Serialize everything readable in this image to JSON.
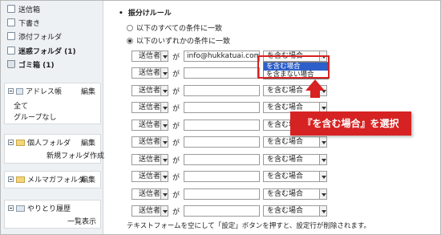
{
  "sidebar": {
    "folders": [
      {
        "label": "送信箱",
        "bold": false,
        "icon": "outbox-icon"
      },
      {
        "label": "下書き",
        "bold": false,
        "icon": "draft-icon"
      },
      {
        "label": "添付フォルダ",
        "bold": false,
        "icon": "attachment-folder-icon"
      },
      {
        "label": "迷惑フォルダ (1)",
        "bold": true,
        "icon": "spam-folder-icon"
      },
      {
        "label": "ゴミ箱 (1)",
        "bold": true,
        "icon": "trash-icon"
      }
    ],
    "address_book": {
      "title": "アドレス帳",
      "edit": "編集",
      "items": [
        "全て",
        "グループなし"
      ]
    },
    "personal": {
      "title": "個人フォルダ",
      "edit": "編集",
      "create": "新規フォルダ作成"
    },
    "magazine": {
      "title": "メルマガフォルダ",
      "edit": "編集"
    },
    "history": {
      "title": "やりとり履歴",
      "list": "一覧表示"
    }
  },
  "filter": {
    "heading": "振分けルール",
    "radio_all": "以下のすべての条件に一致",
    "radio_any": "以下のいずれかの条件に一致",
    "selected_radio": "any",
    "rows": [
      {
        "field": "送信者",
        "ga": "が",
        "value": "info@hukkatuai.com",
        "condition": "を含む場合"
      },
      {
        "field": "送信者",
        "ga": "が",
        "value": "",
        "condition": ""
      },
      {
        "field": "送信者",
        "ga": "が",
        "value": "",
        "condition": "を含む場合"
      },
      {
        "field": "送信者",
        "ga": "が",
        "value": "",
        "condition": "を含む場合"
      },
      {
        "field": "送信者",
        "ga": "が",
        "value": "",
        "condition": "を含む場合"
      },
      {
        "field": "送信者",
        "ga": "が",
        "value": "",
        "condition": "を含む場合"
      },
      {
        "field": "送信者",
        "ga": "が",
        "value": "",
        "condition": "を含む場合"
      },
      {
        "field": "送信者",
        "ga": "が",
        "value": "",
        "condition": "を含む場合"
      },
      {
        "field": "送信者",
        "ga": "が",
        "value": "",
        "condition": "を含む場合"
      },
      {
        "field": "送信者",
        "ga": "が",
        "value": "",
        "condition": "を含む場合"
      }
    ],
    "dropdown_options": [
      "を含む場合",
      "を含まない場合"
    ],
    "note": "テキストフォームを空にして「設定」ボタンを押すと、設定行が削除されます。"
  },
  "callout": {
    "text": "『を含む場合』を選択",
    "color": "#d62222"
  },
  "colors": {
    "highlight": "#2c5fc9",
    "sidebar_bg": "#eef1f4"
  }
}
